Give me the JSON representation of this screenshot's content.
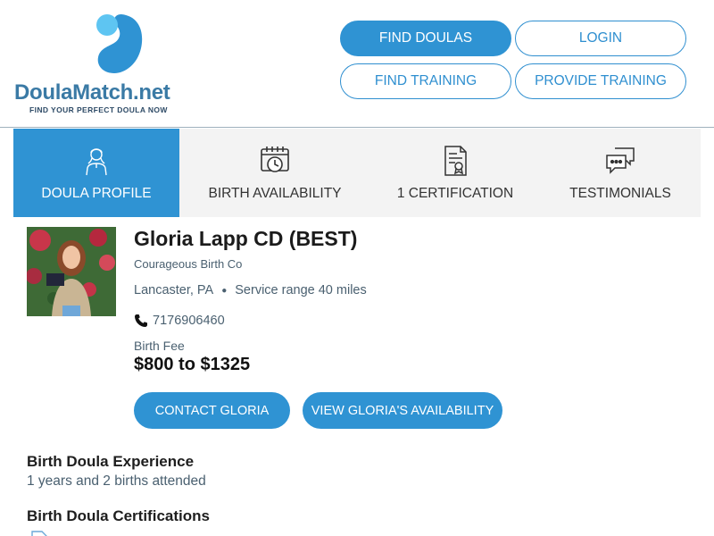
{
  "logo": {
    "brand": "DoulaMatch.net",
    "tagline": "FIND YOUR PERFECT DOULA NOW"
  },
  "nav": {
    "find_doulas": "FIND DOULAS",
    "login": "LOGIN",
    "find_training": "FIND TRAINING",
    "provide_training": "PROVIDE TRAINING"
  },
  "tabs": [
    {
      "label": "DOULA PROFILE",
      "icon": "person-icon",
      "active": true
    },
    {
      "label": "BIRTH AVAILABILITY",
      "icon": "calendar-clock-icon",
      "active": false
    },
    {
      "label": "1 CERTIFICATION",
      "icon": "certificate-icon",
      "active": false
    },
    {
      "label": "TESTIMONIALS",
      "icon": "chat-bubbles-icon",
      "active": false
    }
  ],
  "profile": {
    "name": "Gloria Lapp CD (BEST)",
    "company": "Courageous Birth Co",
    "location": "Lancaster, PA",
    "service_range": "Service range 40 miles",
    "phone": "7176906460",
    "fee_label": "Birth Fee",
    "fee_value": "$800 to $1325"
  },
  "actions": {
    "contact": "CONTACT GLORIA",
    "availability": "VIEW GLORIA'S AVAILABILITY"
  },
  "sections": {
    "experience_title": "Birth Doula Experience",
    "experience_text": "1 years and 2 births attended",
    "certifications_title": "Birth Doula Certifications"
  },
  "colors": {
    "primary": "#2f93d3",
    "brand_text": "#3a7aa5",
    "muted_text": "#4a6070",
    "tab_bg": "#f3f3f3"
  }
}
